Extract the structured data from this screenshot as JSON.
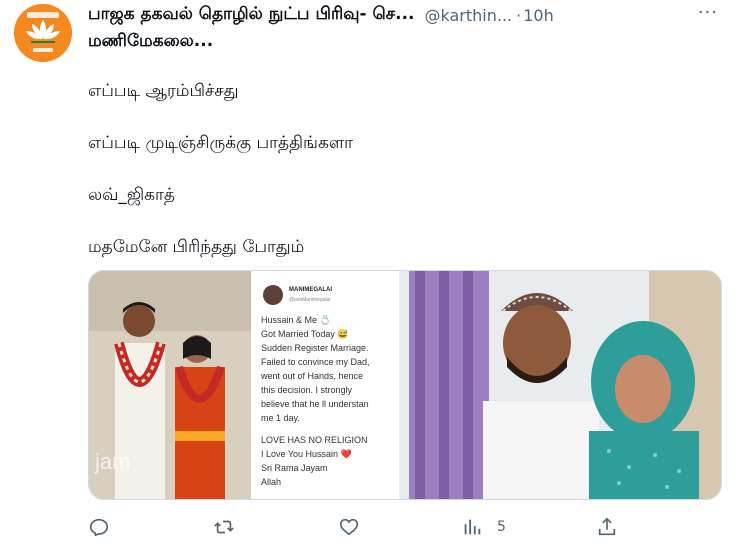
{
  "tweet": {
    "author_name": "பாஜக தகவல் தொழில் நுட்ப பிரிவு- செ...",
    "handle": "@karthin...",
    "separator": "·",
    "time": "10h",
    "more": "···",
    "author_name_line2": "மணிமேகலை...",
    "lines": [
      "எப்படி ஆரம்பிச்சது",
      "எப்படி முடிஞ்சிருக்கு பாத்திங்களா",
      "லவ்_ஜிகாத்",
      "மதமேனே பிரிந்தது போதும்"
    ]
  },
  "media": {
    "watermark": "jam",
    "embedded_post": {
      "name": "MANIMEGALAI",
      "handle": "@iamManimegalai",
      "text_lines": [
        "Hussain & Me 💍",
        "Got Married Today 😅",
        "Sudden Register Marriage.",
        "Failed to convince my Dad,",
        "went out of Hands, hence",
        "this decision. I strongly",
        "believe that he ll understan",
        "me 1 day."
      ],
      "text_lines_2": [
        "LOVE HAS NO RELIGION",
        "I Love You Hussain ❤️",
        "Sri Rama Jayam",
        "Allah"
      ]
    }
  },
  "actions": {
    "reply_count": "",
    "retweet_count": "",
    "like_count": "",
    "views_count": "5"
  },
  "colors": {
    "text": "#0f1419",
    "secondary": "#536471",
    "avatar_bg": "#f5891f",
    "border": "#cfd9de"
  }
}
